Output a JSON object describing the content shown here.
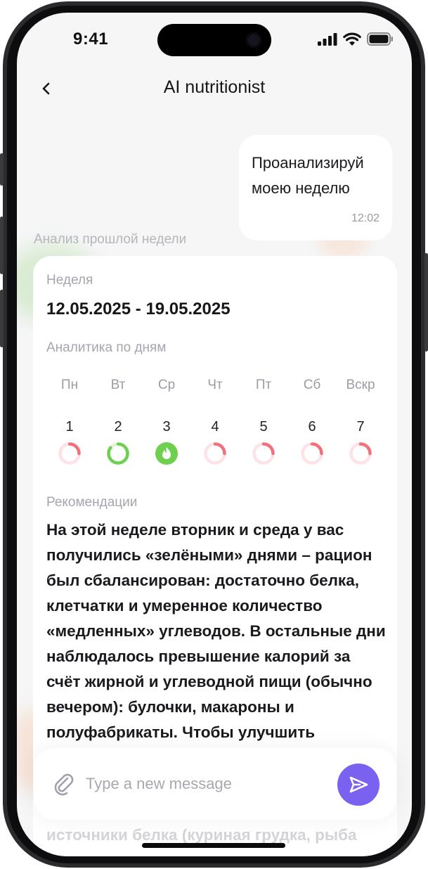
{
  "status_bar": {
    "time": "9:41"
  },
  "header": {
    "title": "AI nutritionist"
  },
  "chat": {
    "user_message": {
      "text": "Проанализируй моею неделю",
      "time": "12:02"
    },
    "assistant_label": "Анализ прошлой недели"
  },
  "card": {
    "week_label": "Неделя",
    "week_range": "12.05.2025 - 19.05.2025",
    "daily_label": "Аналитика по дням",
    "days": [
      {
        "name": "Пн",
        "number": "1",
        "status": "over",
        "progress": 0.25
      },
      {
        "name": "Вт",
        "number": "2",
        "status": "good",
        "progress": 0.85
      },
      {
        "name": "Ср",
        "number": "3",
        "status": "best",
        "progress": 1.0
      },
      {
        "name": "Чт",
        "number": "4",
        "status": "over",
        "progress": 0.25
      },
      {
        "name": "Пт",
        "number": "5",
        "status": "over",
        "progress": 0.25
      },
      {
        "name": "Сб",
        "number": "6",
        "status": "over",
        "progress": 0.25
      },
      {
        "name": "Вскр",
        "number": "7",
        "status": "over",
        "progress": 0.25
      }
    ],
    "recommendations_label": "Рекомендации",
    "recommendations_text": "На этой неделе вторник и среда у вас получились «зелёными» днями – рацион был сбалансирован: достаточно белка, клетчатки и умеренное количество «медленных» углеводов. В остальные дни наблюдалось превышение калорий за счёт жирной и углеводной пищи (обычно вечером): булочки, макароны и полуфабрикаты. Чтобы улучшить",
    "recommendations_continued": "источники белка (куриная грудка, рыба"
  },
  "composer": {
    "placeholder": "Type a new message"
  },
  "colors": {
    "accent": "#7b61f0",
    "ring_over": "#f2707a",
    "ring_over_track": "#fde3e5",
    "ring_good": "#6fd04f",
    "ring_good_track": "#dff5d6"
  },
  "icons": {
    "back": "chevron-left-icon",
    "attach": "paperclip-icon",
    "send": "send-icon",
    "best_day": "flame-icon"
  }
}
